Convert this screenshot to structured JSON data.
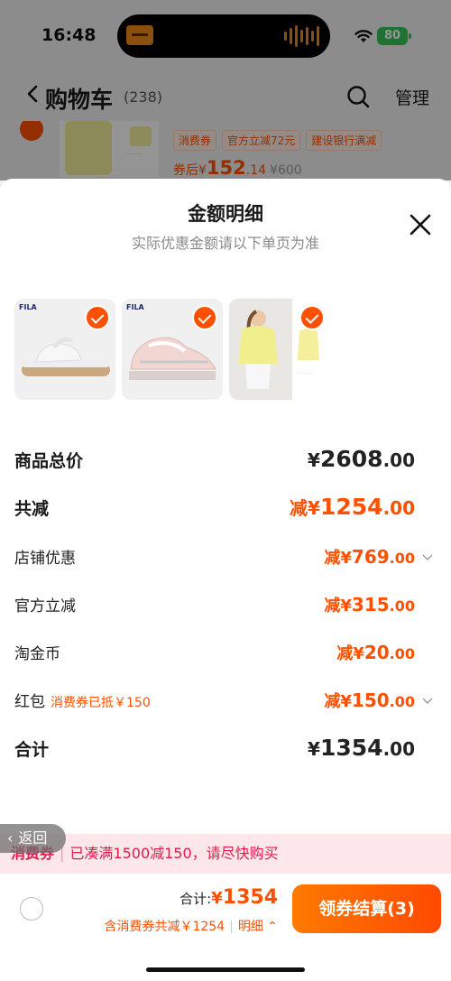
{
  "status_bar": {
    "time": "16:48",
    "battery": "80"
  },
  "cart": {
    "title": "购物车",
    "count": "(238)",
    "manage": "管理",
    "item": {
      "tags": [
        "消费券",
        "官方立减72元",
        "建设银行满减"
      ],
      "after_label": "券后",
      "after_yen": "¥",
      "after_int": "152",
      "after_dec": ".14",
      "original_price": "¥600"
    }
  },
  "sheet": {
    "title": "金额明细",
    "subtitle": "实际优惠金额请以下单页为准",
    "thumbnails": [
      {
        "brand": "FILA",
        "icon": "sandal",
        "checked": true
      },
      {
        "brand": "FILA",
        "icon": "sneaker",
        "checked": true
      },
      {
        "brand": "",
        "icon": "coat",
        "checked": true
      }
    ],
    "rows": {
      "goods_total": {
        "label": "商品总价",
        "yen": "¥",
        "int": "2608",
        "dec": ".00"
      },
      "total_discount": {
        "label": "共减",
        "prefix": "减¥",
        "int": "1254",
        "dec": ".00"
      },
      "shop_discount": {
        "label": "店铺优惠",
        "prefix": "减¥",
        "int": "769",
        "dec": ".00"
      },
      "official_discount": {
        "label": "官方立减",
        "prefix": "减¥",
        "int": "315",
        "dec": ".00"
      },
      "taojin_coin": {
        "label": "淘金币",
        "prefix": "减¥",
        "int": "20",
        "dec": ".00"
      },
      "red_packet": {
        "label": "红包",
        "note": "消费券已抵￥150",
        "prefix": "减¥",
        "int": "150",
        "dec": ".00"
      },
      "grand_total": {
        "label": "合计",
        "yen": "¥",
        "int": "1354",
        "dec": ".00"
      }
    }
  },
  "float_back": {
    "label": "返回"
  },
  "promo": {
    "tag": "消费券",
    "text": "已凑满1500减150，请尽快购买"
  },
  "bottom": {
    "total_label": "合计:",
    "total_yen": "¥",
    "total_value": "1354",
    "discount_text": "含消费券共减￥1254",
    "detail_label": "明细",
    "checkout_label": "领券结算(3)"
  },
  "colors": {
    "accent": "#ff5000",
    "promo_text": "#e21b4b",
    "promo_bg": "#fde7ea"
  }
}
